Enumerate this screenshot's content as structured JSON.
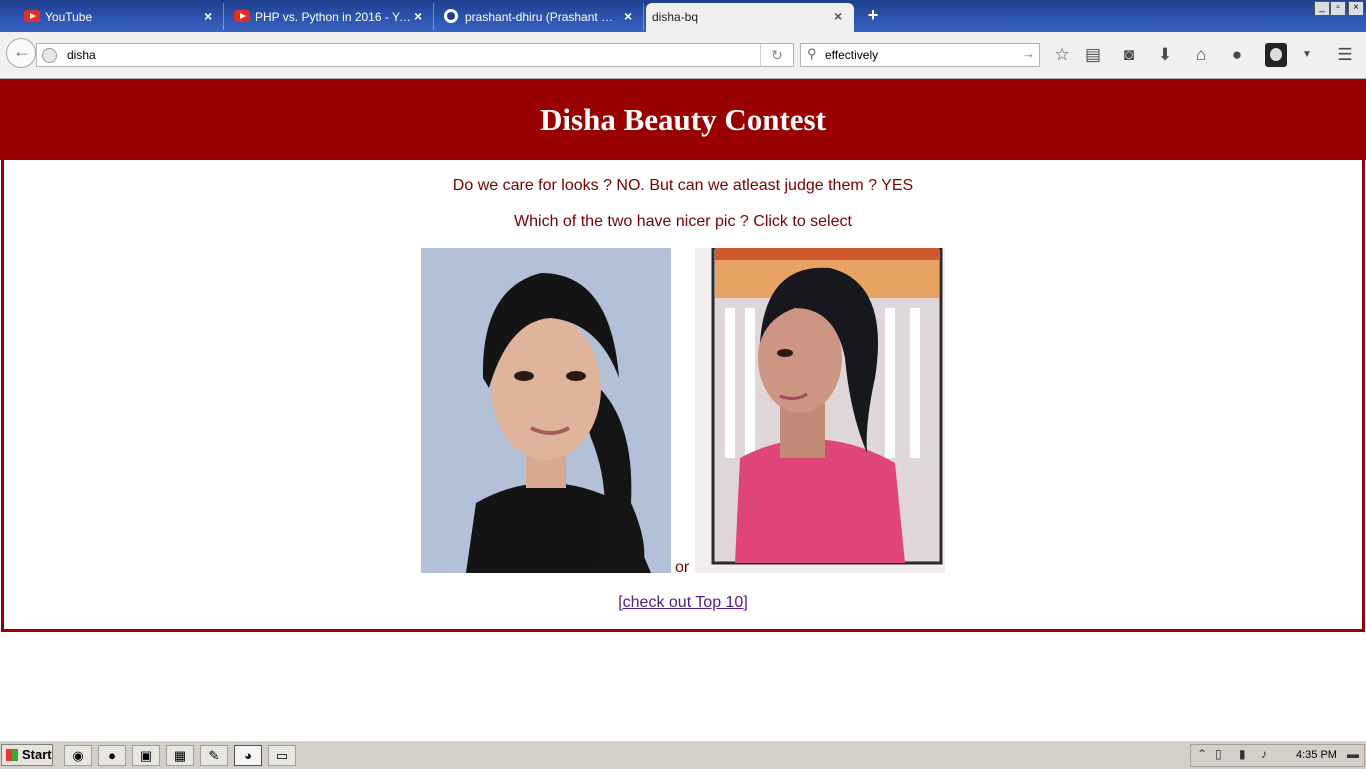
{
  "browser": {
    "tabs": [
      {
        "label": "YouTube",
        "icon": "youtube-icon",
        "active": false
      },
      {
        "label": "PHP vs. Python in 2016 - You…",
        "icon": "youtube-icon",
        "active": false
      },
      {
        "label": "prashant-dhiru (Prashant Dhir…",
        "icon": "github-icon",
        "active": false
      },
      {
        "label": "disha-bq",
        "icon": "none",
        "active": true
      }
    ],
    "close_glyph": "×",
    "new_tab_glyph": "+",
    "url": "disha",
    "search_value": "effectively"
  },
  "page": {
    "header_title": "Disha Beauty Contest",
    "tagline": "Do we care for looks ? NO. But can we atleast judge them ? YES",
    "prompt": "Which of the two have nicer pic ? Click to select",
    "or_text": "or",
    "top10_link": "[check out Top 10]",
    "colors": {
      "banner": "#990000",
      "text": "#7a0000",
      "link": "#551a8b"
    }
  },
  "taskbar": {
    "start_label": "Start",
    "clock": "4:35 PM"
  }
}
